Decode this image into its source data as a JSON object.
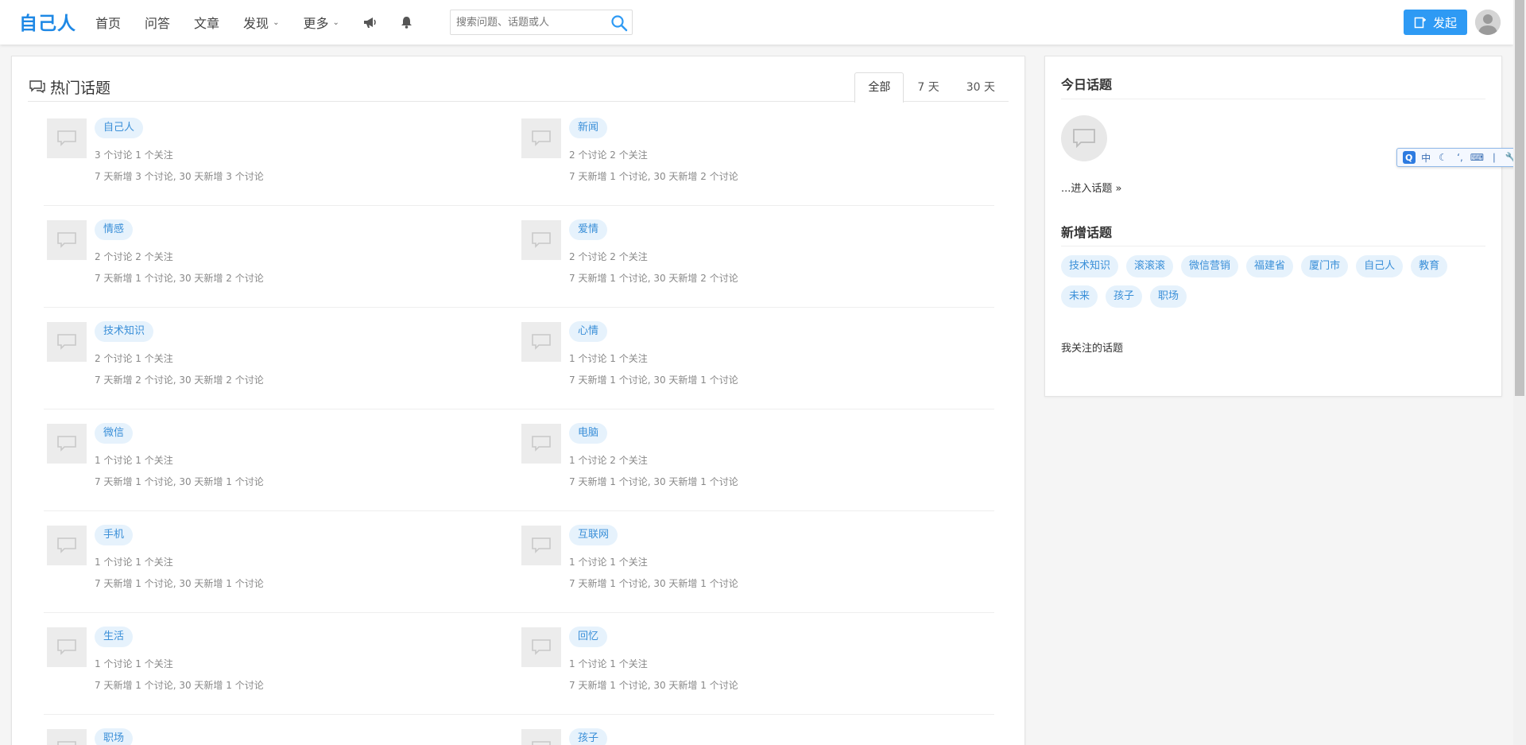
{
  "header": {
    "logo": "自己人",
    "nav": [
      {
        "label": "首页"
      },
      {
        "label": "问答"
      },
      {
        "label": "文章"
      },
      {
        "label": "发现",
        "dropdown": true
      },
      {
        "label": "更多",
        "dropdown": true
      }
    ],
    "icons": [
      "megaphone-icon",
      "bell-icon"
    ],
    "search_placeholder": "搜索问题、话题或人",
    "post_button": "发起",
    "accent_color": "#2e9af4"
  },
  "main": {
    "title": "热门话题",
    "tabs": [
      {
        "label": "全部",
        "active": true
      },
      {
        "label": "7 天",
        "active": false
      },
      {
        "label": "30 天",
        "active": false
      }
    ],
    "topics": [
      {
        "name": "自己人",
        "stats": "3 个讨论 1 个关注",
        "recent": "7 天新增 3 个讨论, 30 天新增 3 个讨论"
      },
      {
        "name": "新闻",
        "stats": "2 个讨论 2 个关注",
        "recent": "7 天新增 1 个讨论, 30 天新增 2 个讨论"
      },
      {
        "name": "情感",
        "stats": "2 个讨论 2 个关注",
        "recent": "7 天新增 1 个讨论, 30 天新增 2 个讨论"
      },
      {
        "name": "爱情",
        "stats": "2 个讨论 2 个关注",
        "recent": "7 天新增 1 个讨论, 30 天新增 2 个讨论"
      },
      {
        "name": "技术知识",
        "stats": "2 个讨论 1 个关注",
        "recent": "7 天新增 2 个讨论, 30 天新增 2 个讨论"
      },
      {
        "name": "心情",
        "stats": "1 个讨论 1 个关注",
        "recent": "7 天新增 1 个讨论, 30 天新增 1 个讨论"
      },
      {
        "name": "微信",
        "stats": "1 个讨论 1 个关注",
        "recent": "7 天新增 1 个讨论, 30 天新增 1 个讨论"
      },
      {
        "name": "电脑",
        "stats": "1 个讨论 2 个关注",
        "recent": "7 天新增 1 个讨论, 30 天新增 1 个讨论"
      },
      {
        "name": "手机",
        "stats": "1 个讨论 1 个关注",
        "recent": "7 天新增 1 个讨论, 30 天新增 1 个讨论"
      },
      {
        "name": "互联网",
        "stats": "1 个讨论 1 个关注",
        "recent": "7 天新增 1 个讨论, 30 天新增 1 个讨论"
      },
      {
        "name": "生活",
        "stats": "1 个讨论 1 个关注",
        "recent": "7 天新增 1 个讨论, 30 天新增 1 个讨论"
      },
      {
        "name": "回忆",
        "stats": "1 个讨论 1 个关注",
        "recent": "7 天新增 1 个讨论, 30 天新增 1 个讨论"
      },
      {
        "name": "职场",
        "stats": "",
        "recent": ""
      },
      {
        "name": "孩子",
        "stats": "",
        "recent": ""
      }
    ]
  },
  "sidebar": {
    "today_title": "今日话题",
    "enter_link": "...进入话题 »",
    "new_title": "新增话题",
    "new_tags": [
      "技术知识",
      "滚滚滚",
      "微信营销",
      "福建省",
      "厦门市",
      "自己人",
      "教育",
      "未来",
      "孩子",
      "职场"
    ],
    "follow_title": "我关注的话题"
  },
  "ime": {
    "logo": "Q",
    "mode": "中",
    "icons": [
      "moon-icon",
      "punctuation-icon",
      "keyboard-icon",
      "split-icon",
      "wrench-icon"
    ]
  }
}
